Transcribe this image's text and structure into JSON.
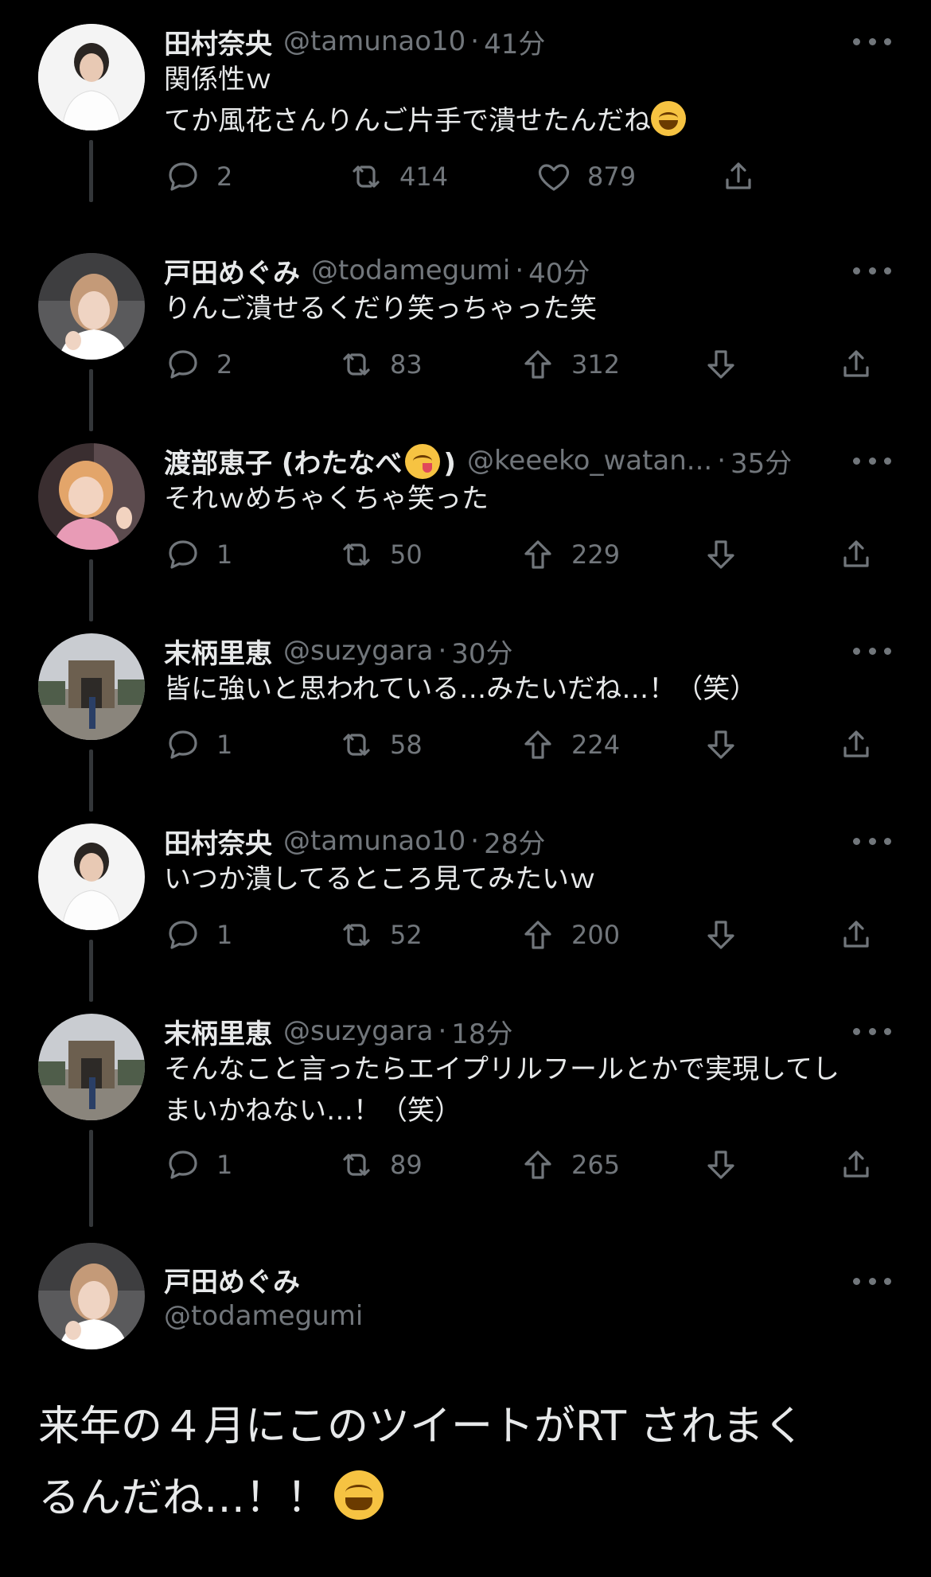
{
  "replies": [
    {
      "name": "田村奈央",
      "handle": "@tamunao10",
      "time": "41分",
      "lines": [
        "関係性ｗ",
        "てか風花さんりんご片手で潰せたんだね"
      ],
      "emoji_after_last_line": "face-with-tears-of-joy",
      "style": "like",
      "reply_count": "2",
      "retweet_count": "414",
      "like_count": "879"
    },
    {
      "name": "戸田めぐみ",
      "handle": "@todamegumi",
      "time": "40分",
      "lines": [
        "りんご潰せるくだり笑っちゃった笑"
      ],
      "style": "vote",
      "reply_count": "2",
      "retweet_count": "83",
      "upvote_count": "312"
    },
    {
      "name": "渡部恵子 (わたなべ",
      "name_suffix": ")",
      "name_emoji": "face-savoring-food",
      "handle": "@keeeko_watan...",
      "time": "35分",
      "lines": [
        "それｗめちゃくちゃ笑った"
      ],
      "style": "vote",
      "reply_count": "1",
      "retweet_count": "50",
      "upvote_count": "229"
    },
    {
      "name": "末柄里恵",
      "handle": "@suzygara",
      "time": "30分",
      "lines": [
        "皆に強いと思われている…みたいだね…！（笑）"
      ],
      "style": "vote",
      "reply_count": "1",
      "retweet_count": "58",
      "upvote_count": "224"
    },
    {
      "name": "田村奈央",
      "handle": "@tamunao10",
      "time": "28分",
      "lines": [
        "いつか潰してるところ見てみたいｗ"
      ],
      "style": "vote",
      "reply_count": "1",
      "retweet_count": "52",
      "upvote_count": "200"
    },
    {
      "name": "末柄里恵",
      "handle": "@suzygara",
      "time": "18分",
      "lines": [
        "そんなこと言ったらエイプリルフールとかで実現してし",
        "まいかねない…！（笑）"
      ],
      "style": "vote",
      "reply_count": "1",
      "retweet_count": "89",
      "upvote_count": "265"
    }
  ],
  "main_tweet": {
    "name": "戸田めぐみ",
    "handle": "@todamegumi",
    "line1": "来年の４月にこのツイートがRT されまく",
    "line2": "るんだね…！！",
    "emoji": "face-with-tears-of-joy"
  },
  "colors": {
    "background": "#000000",
    "text": "#e7e9ea",
    "secondary": "#71767b",
    "thread_line": "#333639"
  },
  "icons": [
    "reply-icon",
    "retweet-icon",
    "like-icon",
    "upvote-icon",
    "downvote-icon",
    "share-icon",
    "more-icon"
  ]
}
